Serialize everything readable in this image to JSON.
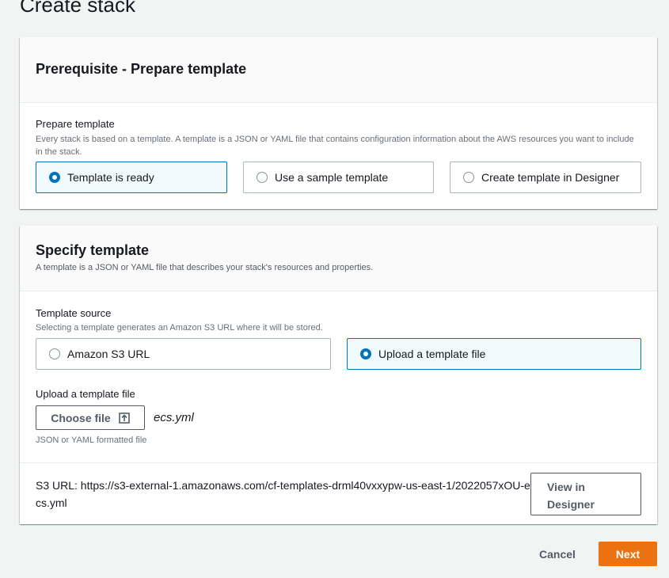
{
  "page": {
    "title": "Create stack"
  },
  "prerequisite": {
    "heading": "Prerequisite - Prepare template",
    "field_label": "Prepare template",
    "field_desc": "Every stack is based on a template. A template is a JSON or YAML file that contains configuration information about the AWS resources you want to include in the stack.",
    "options": [
      {
        "label": "Template is ready",
        "selected": true
      },
      {
        "label": "Use a sample template",
        "selected": false
      },
      {
        "label": "Create template in Designer",
        "selected": false
      }
    ]
  },
  "specify": {
    "heading": "Specify template",
    "desc": "A template is a JSON or YAML file that describes your stack's resources and properties.",
    "source_label": "Template source",
    "source_desc": "Selecting a template generates an Amazon S3 URL where it will be stored.",
    "source_options": [
      {
        "label": "Amazon S3 URL",
        "selected": false
      },
      {
        "label": "Upload a template file",
        "selected": true
      }
    ],
    "upload_label": "Upload a template file",
    "choose_file_label": "Choose file",
    "file_name": "ecs.yml",
    "file_hint": "JSON or YAML formatted file",
    "s3_url_text": "S3 URL:  https://s3-external-1.amazonaws.com/cf-templates-drml40vxxypw-us-east-1/2022057xOU-ecs.yml",
    "view_in_designer_label": "View in Designer"
  },
  "footer": {
    "cancel_label": "Cancel",
    "next_label": "Next"
  },
  "colors": {
    "accent": "#0073bb",
    "primary_button": "#ec7211"
  }
}
